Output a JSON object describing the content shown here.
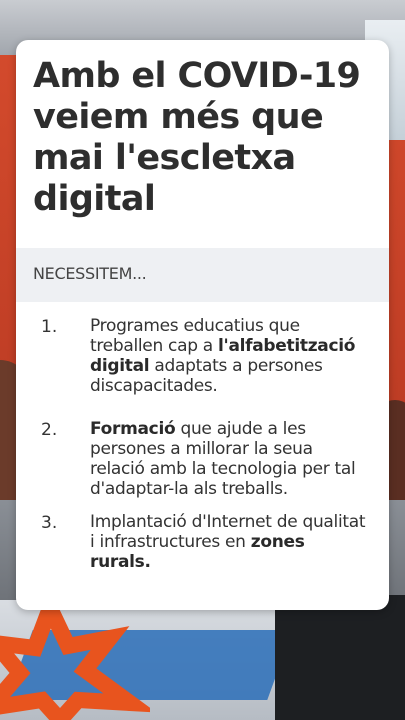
{
  "card": {
    "title": "Amb el COVID-19 veiem més que mai l'escletxa digital",
    "section_label": "NECESSITEM...",
    "items": [
      {
        "number": "1.",
        "pre": "Programes educatius que treballen cap a ",
        "bold": "l'alfabetització digital",
        "post": " adaptats a persones discapacitades."
      },
      {
        "number": "2.",
        "pre": "",
        "bold": "Formació",
        "post": " que ajude a les persones a millorar la seua relació amb la tecnologia per tal d'adaptar-la als treballs."
      },
      {
        "number": "3.",
        "pre": "Implantació d'Internet de qualitat i infrastructures en ",
        "bold": "zones rurals.",
        "post": ""
      }
    ]
  },
  "colors": {
    "accent_star": "#e8541e",
    "wall": "#d34a2c",
    "section_bar": "#eef0f3",
    "text": "#333333"
  },
  "icons": {
    "decor": "star-shape"
  }
}
